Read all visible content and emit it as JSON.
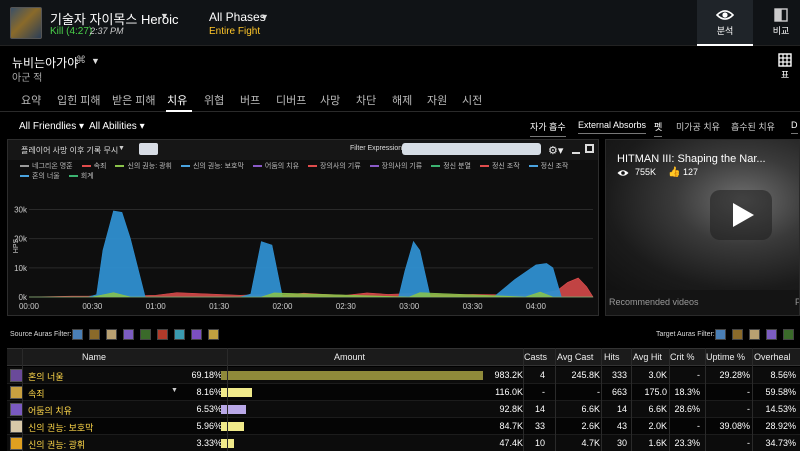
{
  "header": {
    "boss_name": "기술자 자이목스 Heroic",
    "kill_text": "Kill (4:27)",
    "kill_time": "2:37 PM",
    "phase_label": "All Phases",
    "phase_sub": "Entire Fight",
    "analyze_label": "분석",
    "compare_label": "비교"
  },
  "player": {
    "name": "뉴비는아가야",
    "mark": "⌘",
    "subtitle": "아군 적",
    "table_label": "표"
  },
  "tabs": [
    "요약",
    "입힌 피해",
    "받은 피해",
    "치유",
    "위협",
    "버프",
    "디버프",
    "사망",
    "차단",
    "해제",
    "자원",
    "시전"
  ],
  "active_tab": "치유",
  "filters": {
    "friendlies": "All Friendlies ▾",
    "abilities": "All Abilities ▾",
    "options": [
      "자가 흡수",
      "External Absorbs",
      "펫",
      "미가공 치유",
      "흡수된 치유",
      "D"
    ]
  },
  "graph": {
    "mode": "플레이어 사망 이후 기록 무시",
    "filter_label": "Filter Expression:",
    "filter_value": "",
    "legend": [
      {
        "name": "네그리온 명훈",
        "color": "#9a9a9a"
      },
      {
        "name": "속죄",
        "color": "#e04c4c"
      },
      {
        "name": "신의 권능: 광휘",
        "color": "#8ac34a"
      },
      {
        "name": "신의 권능: 보호막",
        "color": "#4aa3df"
      },
      {
        "name": "어둠의 치유",
        "color": "#8a5ac7"
      },
      {
        "name": "장의사의 기류",
        "color": "#e04c4c"
      },
      {
        "name": "장의사의 기류",
        "color": "#8a5ac7"
      },
      {
        "name": "정신 분열",
        "color": "#3cb371"
      },
      {
        "name": "정신 조작",
        "color": "#e04c4c"
      },
      {
        "name": "정신 조작",
        "color": "#4aa3df"
      },
      {
        "name": "혼의 너울",
        "color": "#4aa3df"
      },
      {
        "name": "회계",
        "color": "#3cb371"
      }
    ]
  },
  "chart_data": {
    "type": "area",
    "x_ticks": [
      "00:00",
      "00:30",
      "01:00",
      "01:30",
      "02:00",
      "02:30",
      "03:00",
      "03:30",
      "04:00"
    ],
    "y_ticks": [
      "0k",
      "10k",
      "20k",
      "30k"
    ],
    "ylabel": "HPS",
    "ylim": [
      0,
      36000
    ],
    "xlim": [
      0,
      267
    ],
    "series": [
      {
        "name": "혼의 너울",
        "color": "#2f8fd0",
        "x": [
          0,
          10,
          20,
          28,
          32,
          35,
          40,
          44,
          48,
          55,
          65,
          75,
          85,
          95,
          100,
          105,
          110,
          115,
          120,
          125,
          130,
          140,
          150,
          160,
          170,
          175,
          178,
          182,
          185,
          190,
          195,
          200,
          205,
          210,
          220,
          230,
          240,
          245,
          248,
          252,
          256,
          260,
          264,
          267
        ],
        "y": [
          0,
          0,
          0,
          0,
          800,
          16000,
          29500,
          29000,
          20000,
          0,
          0,
          0,
          0,
          0,
          0,
          1000,
          19000,
          17800,
          0,
          0,
          0,
          0,
          0,
          0,
          0,
          0,
          9000,
          19000,
          16000,
          0,
          0,
          0,
          0,
          0,
          0,
          6000,
          11000,
          11500,
          10000,
          0,
          0,
          0,
          0,
          0
        ]
      },
      {
        "name": "속죄",
        "color": "#e04c4c",
        "x": [
          0,
          20,
          28,
          40,
          50,
          60,
          70,
          80,
          90,
          100,
          110,
          120,
          130,
          140,
          150,
          160,
          170,
          180,
          190,
          200,
          210,
          220,
          230,
          240,
          250,
          255,
          260,
          264,
          267
        ],
        "y": [
          0,
          300,
          300,
          700,
          400,
          600,
          1500,
          1200,
          900,
          600,
          800,
          600,
          1300,
          900,
          600,
          1400,
          900,
          1200,
          800,
          700,
          900,
          800,
          700,
          900,
          2200,
          5000,
          6500,
          3500,
          0
        ]
      },
      {
        "name": "신의 권능: 광휘",
        "color": "#8ac34a",
        "x": [
          0,
          30,
          40,
          48,
          110,
          116,
          180,
          185,
          235,
          242,
          248,
          267
        ],
        "y": [
          0,
          0,
          1500,
          0,
          0,
          1400,
          0,
          1500,
          0,
          1700,
          0,
          0
        ]
      }
    ]
  },
  "video": {
    "title": "HITMAN III: Shaping the Nar...",
    "views": "755K",
    "likes": "127",
    "recommended": "Recommended videos",
    "more": "P"
  },
  "auras": {
    "source_label": "Source Auras Filter:",
    "target_label": "Target Auras Filter:",
    "source_colors": [
      "#4a7fb6",
      "#8a6a2a",
      "#b8a071",
      "#7b5cc0",
      "#3a6a2a",
      "#b03a2a",
      "#3a9ab0",
      "#7b4fc0",
      "#c0a040"
    ],
    "target_colors": [
      "#4a7fb6",
      "#8a6a2a",
      "#b8a071",
      "#7b5cc0",
      "#3a6a2a"
    ]
  },
  "table": {
    "headers": [
      "Name",
      "Amount",
      "Casts",
      "Avg Cast",
      "Hits",
      "Avg Hit",
      "Crit %",
      "Uptime %",
      "Overheal"
    ],
    "rows": [
      {
        "name": "혼의 너울",
        "pct": "69.18%",
        "pct_value": 69.18,
        "bar_color": "#8f8a3a",
        "amount": "983.2K",
        "casts": "4",
        "avg_cast": "245.8K",
        "hits": "333",
        "avg_hit": "3.0K",
        "crit": "-",
        "uptime": "29.28%",
        "overheal": "8.56%",
        "icon_color": "#6a4a9a",
        "caret": ""
      },
      {
        "name": "속죄",
        "pct": "8.16%",
        "pct_value": 8.16,
        "bar_color": "#f0ea8a",
        "amount": "116.0K",
        "casts": "-",
        "avg_cast": "-",
        "hits": "663",
        "avg_hit": "175.0",
        "crit": "18.3%",
        "uptime": "-",
        "overheal": "59.58%",
        "icon_color": "#c8a040",
        "caret": "▼"
      },
      {
        "name": "어둠의 치유",
        "pct": "6.53%",
        "pct_value": 6.53,
        "bar_color": "#b9a8e8",
        "amount": "92.8K",
        "casts": "14",
        "avg_cast": "6.6K",
        "hits": "14",
        "avg_hit": "6.6K",
        "crit": "28.6%",
        "uptime": "-",
        "overheal": "14.53%",
        "icon_color": "#7a5ac0",
        "caret": ""
      },
      {
        "name": "신의 권능: 보호막",
        "pct": "5.96%",
        "pct_value": 5.96,
        "bar_color": "#f0ea8a",
        "amount": "84.7K",
        "casts": "33",
        "avg_cast": "2.6K",
        "hits": "43",
        "avg_hit": "2.0K",
        "crit": "-",
        "uptime": "39.08%",
        "overheal": "28.92%",
        "icon_color": "#d8c8a8",
        "caret": ""
      },
      {
        "name": "신의 권능: 광휘",
        "pct": "3.33%",
        "pct_value": 3.33,
        "bar_color": "#f0ea8a",
        "amount": "47.4K",
        "casts": "10",
        "avg_cast": "4.7K",
        "hits": "30",
        "avg_hit": "1.6K",
        "crit": "23.3%",
        "uptime": "-",
        "overheal": "34.73%",
        "icon_color": "#e0a020",
        "caret": ""
      }
    ]
  }
}
